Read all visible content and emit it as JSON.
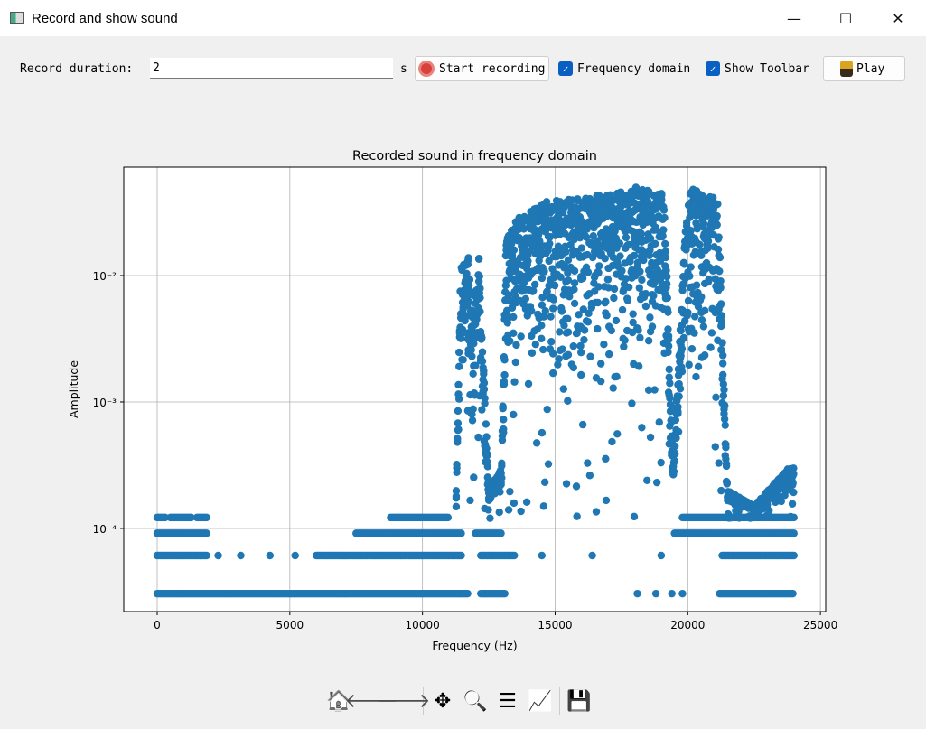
{
  "window": {
    "title": "Record and show sound"
  },
  "toolbar": {
    "duration_label": "Record duration:",
    "duration_value": "2",
    "unit": "s",
    "start_label": "Start recording",
    "freq_label": "Frequency domain",
    "freq_checked": true,
    "toolbar_label": "Show Toolbar",
    "toolbar_checked": true,
    "play_label": "Play"
  },
  "navbar": {
    "icons": [
      "home-icon",
      "back-icon",
      "forward-icon",
      "pan-icon",
      "zoom-icon",
      "configure-subplots-icon",
      "edit-axis-icon",
      "save-icon"
    ]
  },
  "chart_data": {
    "type": "scatter",
    "title": "Recorded sound in frequency domain",
    "xlabel": "Frequency (Hz)",
    "ylabel": "Amplitude",
    "yscale": "log",
    "xlim": [
      -1260,
      25200
    ],
    "ylim": [
      2.2e-05,
      0.072
    ],
    "xticks": [
      0,
      5000,
      10000,
      15000,
      20000,
      25000
    ],
    "xtick_labels": [
      "0",
      "5000",
      "10000",
      "15000",
      "20000",
      "25000"
    ],
    "yticks": [
      0.0001,
      0.001,
      0.01
    ],
    "ytick_labels": [
      "10⁻⁴",
      "10⁻³",
      "10⁻²"
    ],
    "grid": true,
    "color": "#1f77b4",
    "quantized_levels": [
      {
        "amplitude": 3.05e-05,
        "ranges": [
          [
            0,
            11700
          ],
          [
            12200,
            13100
          ],
          [
            18100,
            18100
          ],
          [
            18800,
            18800
          ],
          [
            19400,
            19400
          ],
          [
            19800,
            19800
          ],
          [
            21200,
            24000
          ]
        ]
      },
      {
        "amplitude": 6.1e-05,
        "ranges": [
          [
            0,
            1900
          ],
          [
            2300,
            2300
          ],
          [
            3150,
            3150
          ],
          [
            4250,
            4250
          ],
          [
            5200,
            5200
          ],
          [
            6000,
            11500
          ],
          [
            12200,
            13500
          ],
          [
            14500,
            14500
          ],
          [
            16400,
            16400
          ],
          [
            19000,
            19000
          ],
          [
            21300,
            24000
          ]
        ]
      },
      {
        "amplitude": 9.15e-05,
        "ranges": [
          [
            0,
            1900
          ],
          [
            7500,
            11500
          ],
          [
            12000,
            13000
          ],
          [
            19500,
            24000
          ]
        ]
      },
      {
        "amplitude": 0.000122,
        "ranges": [
          [
            0,
            300
          ],
          [
            500,
            1300
          ],
          [
            1500,
            1900
          ],
          [
            8800,
            11000
          ],
          [
            19800,
            24000
          ]
        ]
      }
    ],
    "envelope": [
      [
        11270,
        0.0002
      ],
      [
        11440,
        0.012
      ],
      [
        11720,
        0.015
      ],
      [
        11920,
        0.004
      ],
      [
        12120,
        0.015
      ],
      [
        12500,
        0.0002
      ],
      [
        12980,
        0.0003
      ],
      [
        13150,
        0.02
      ],
      [
        13660,
        0.03
      ],
      [
        14850,
        0.04
      ],
      [
        15870,
        0.042
      ],
      [
        17230,
        0.045
      ],
      [
        18090,
        0.05
      ],
      [
        19110,
        0.045
      ],
      [
        19450,
        0.0003
      ],
      [
        19960,
        0.04
      ],
      [
        20230,
        0.05
      ],
      [
        21150,
        0.04
      ],
      [
        21490,
        0.0002
      ],
      [
        22500,
        0.00015
      ],
      [
        23800,
        0.0003
      ],
      [
        24000,
        0.0003
      ]
    ]
  }
}
